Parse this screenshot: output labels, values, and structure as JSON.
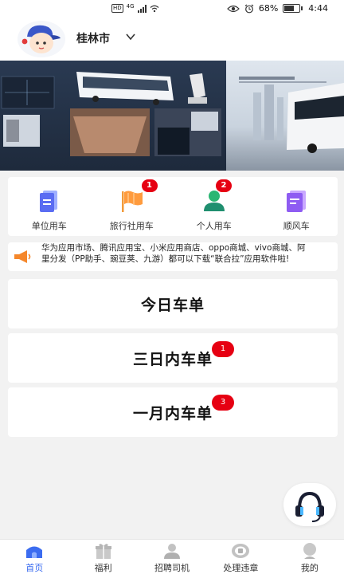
{
  "status_bar": {
    "hd": "HD",
    "network": "4G",
    "battery_percent": "68%",
    "battery_level": 0.68,
    "time": "4:44"
  },
  "header": {
    "city": "桂林市"
  },
  "quick_menu": [
    {
      "label": "单位用车",
      "icon": "company-car-icon",
      "badge": ""
    },
    {
      "label": "旅行社用车",
      "icon": "travel-flag-icon",
      "badge": "1"
    },
    {
      "label": "个人用车",
      "icon": "person-icon",
      "badge": "2"
    },
    {
      "label": "顺风车",
      "icon": "rideshare-icon",
      "badge": ""
    }
  ],
  "notice": {
    "text": "华为应用市场、腾讯应用宝、小米应用商店、oppo商城、vivo商城、阿里分发（PP助手、豌豆荚、九游）都可以下载“联合拉”应用软件啦!"
  },
  "cards": [
    {
      "title": "今日车单",
      "badge": ""
    },
    {
      "title": "三日内车单",
      "badge": "1"
    },
    {
      "title": "一月内车单",
      "badge": "3"
    }
  ],
  "bottom_nav": [
    {
      "label": "首页",
      "icon": "home-icon",
      "active": true
    },
    {
      "label": "福利",
      "icon": "gift-icon",
      "active": false
    },
    {
      "label": "招聘司机",
      "icon": "driver-icon",
      "active": false
    },
    {
      "label": "处理违章",
      "icon": "violation-icon",
      "active": false
    },
    {
      "label": "我的",
      "icon": "profile-icon",
      "active": false
    }
  ],
  "colors": {
    "accent": "#3b6cf0",
    "badge": "#e60012",
    "background": "#f2f2f2"
  }
}
